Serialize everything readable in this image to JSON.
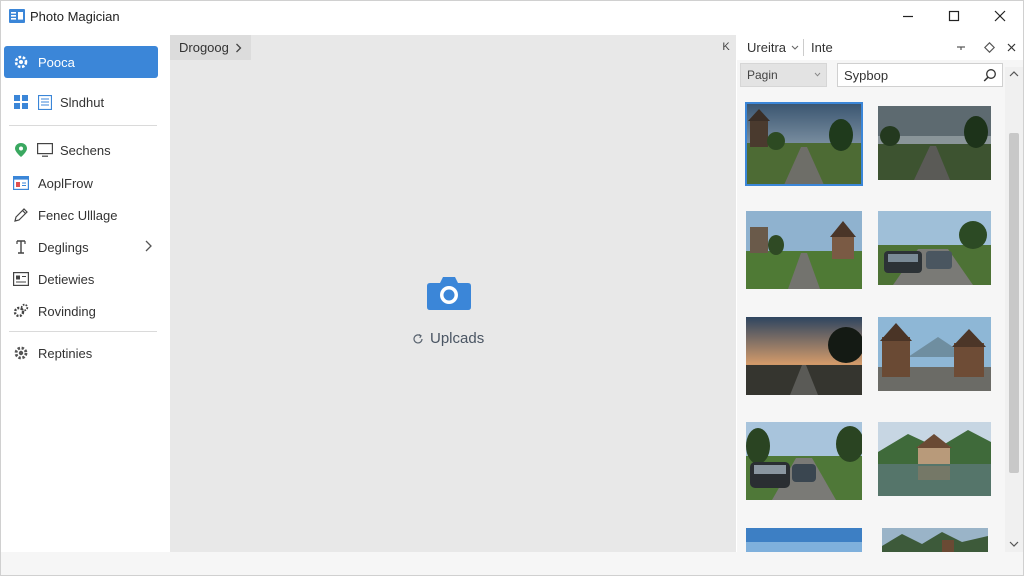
{
  "window": {
    "title": "Photo Magician",
    "controls": [
      "minimize",
      "maximize",
      "close"
    ]
  },
  "sidebar": {
    "items": [
      {
        "label": "Pooca",
        "icon": "gear-icon",
        "active": true
      },
      {
        "label": "Slndhut",
        "icon": "grid-icon"
      },
      {
        "label": "Sechens",
        "icon": "monitor-icon"
      },
      {
        "label": "AoplFrow",
        "icon": "window-icon"
      },
      {
        "label": "Fenec Ulllage",
        "icon": "pencil-icon"
      },
      {
        "label": "Deglings",
        "icon": "tool-icon",
        "has_chevron": true
      },
      {
        "label": "Detiewies",
        "icon": "card-icon"
      },
      {
        "label": "Rovinding",
        "icon": "gears-icon"
      },
      {
        "label": "Reptinies",
        "icon": "settings-icon"
      }
    ]
  },
  "main": {
    "breadcrumb": "Drogoog",
    "upload_label": "Uplcads"
  },
  "right_panel": {
    "tab1": "Ureitra",
    "tab2": "Inte",
    "collapse_glyph": "K",
    "select_value": "Pagin",
    "search_value": "Sypbop",
    "thumbnails": [
      {
        "scene": "road-village",
        "selected": true
      },
      {
        "scene": "road-plain"
      },
      {
        "scene": "road-houses"
      },
      {
        "scene": "cars-road"
      },
      {
        "scene": "sunset-road"
      },
      {
        "scene": "houses-mountain"
      },
      {
        "scene": "cars-field"
      },
      {
        "scene": "lake-house"
      },
      {
        "scene": "sky-partial"
      },
      {
        "scene": "town-partial"
      }
    ]
  },
  "colors": {
    "accent": "#3b86d8",
    "main_bg": "#e8e8e8",
    "panel_bg": "#f6f6f6"
  }
}
